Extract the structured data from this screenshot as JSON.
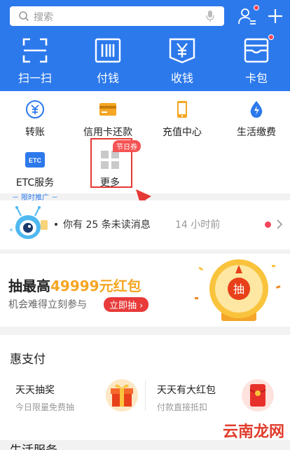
{
  "search": {
    "placeholder": "搜索"
  },
  "top_actions": [
    {
      "label": "扫一扫",
      "icon": "scan-icon"
    },
    {
      "label": "付钱",
      "icon": "pay-barcode-icon"
    },
    {
      "label": "收钱",
      "icon": "collect-money-icon"
    },
    {
      "label": "卡包",
      "icon": "card-wallet-icon"
    }
  ],
  "services": [
    {
      "label": "转账",
      "icon": "transfer-icon"
    },
    {
      "label": "信用卡还款",
      "icon": "credit-card-icon"
    },
    {
      "label": "充值中心",
      "icon": "phone-recharge-icon"
    },
    {
      "label": "生活缴费",
      "icon": "utility-drop-icon"
    }
  ],
  "etc": {
    "icon_text": "ETC",
    "label": "ETC服务",
    "sub": "－ 限时推广 －"
  },
  "more": {
    "label": "更多",
    "badge": "节日券"
  },
  "message": {
    "text": "你有 25 条未读消息",
    "time": "14 小时前"
  },
  "promo": {
    "headline_prefix": "抽最高",
    "amount": "49999元红包",
    "sub": "机会难得立刻参与",
    "button": "立即抽 ›",
    "wheel_text": "抽"
  },
  "hui": {
    "title": "惠支付",
    "cards": [
      {
        "title": "天天抽奖",
        "sub": "今日限量免费抽"
      },
      {
        "title": "天天有大红包",
        "sub": "付款直接抵扣"
      }
    ]
  },
  "life_service_title": "生活服务",
  "watermark": "云南龙网",
  "colors": {
    "primary": "#2c79ec",
    "accent_red": "#e53935",
    "gold": "#f5a623"
  }
}
